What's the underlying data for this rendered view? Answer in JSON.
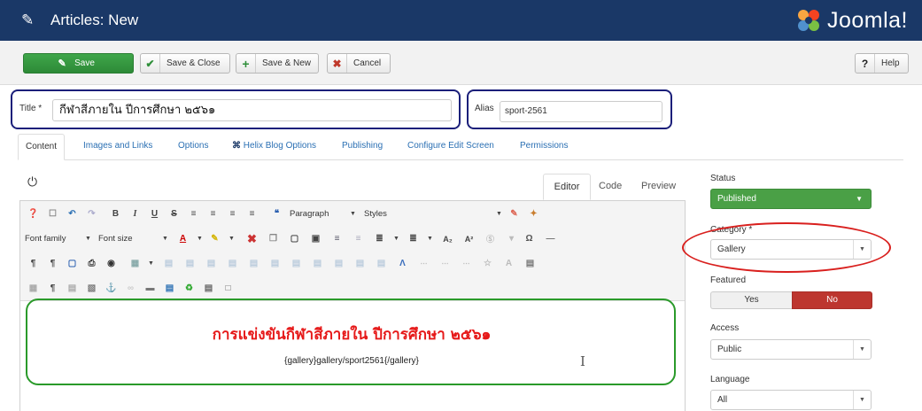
{
  "header": {
    "title": "Articles: New",
    "logo_text": "Joomla!"
  },
  "toolbar": {
    "save_label": "Save",
    "save_close_label": "Save & Close",
    "save_new_label": "Save & New",
    "cancel_label": "Cancel",
    "help_label": "Help"
  },
  "form": {
    "title_label": "Title *",
    "title_value": "กีฬาสีภายใน ปีการศึกษา ๒๕๖๑",
    "alias_label": "Alias",
    "alias_value": "sport-2561"
  },
  "tabs": [
    "Content",
    "Images and Links",
    "Options",
    "Helix Blog Options",
    "Publishing",
    "Configure Edit Screen",
    "Permissions"
  ],
  "editor": {
    "tabs": [
      "Editor",
      "Code",
      "Preview"
    ],
    "format_select": "Paragraph",
    "styles_select": "Styles",
    "font_family_select": "Font family",
    "font_size_select": "Font size",
    "content_heading": "การแข่งขันกีฬาสีภายใน ปีการศึกษา ๒๕๖๑",
    "content_shortcode": "{gallery}gallery/sport2561{/gallery}"
  },
  "sidebar": {
    "status_label": "Status",
    "status_value": "Published",
    "category_label": "Category *",
    "category_value": "Gallery",
    "featured_label": "Featured",
    "featured_yes": "Yes",
    "featured_no": "No",
    "access_label": "Access",
    "access_value": "Public",
    "language_label": "Language",
    "language_value": "All"
  },
  "colors": {
    "header_bg": "#1a3867",
    "save_green": "#2d8a37",
    "status_green": "#4aa046",
    "no_red": "#bd362f",
    "annotation_blue": "#1b1f7a",
    "annotation_red": "#d9201e",
    "annotation_green": "#2a9a2a",
    "heading_red": "#e61a1a"
  }
}
